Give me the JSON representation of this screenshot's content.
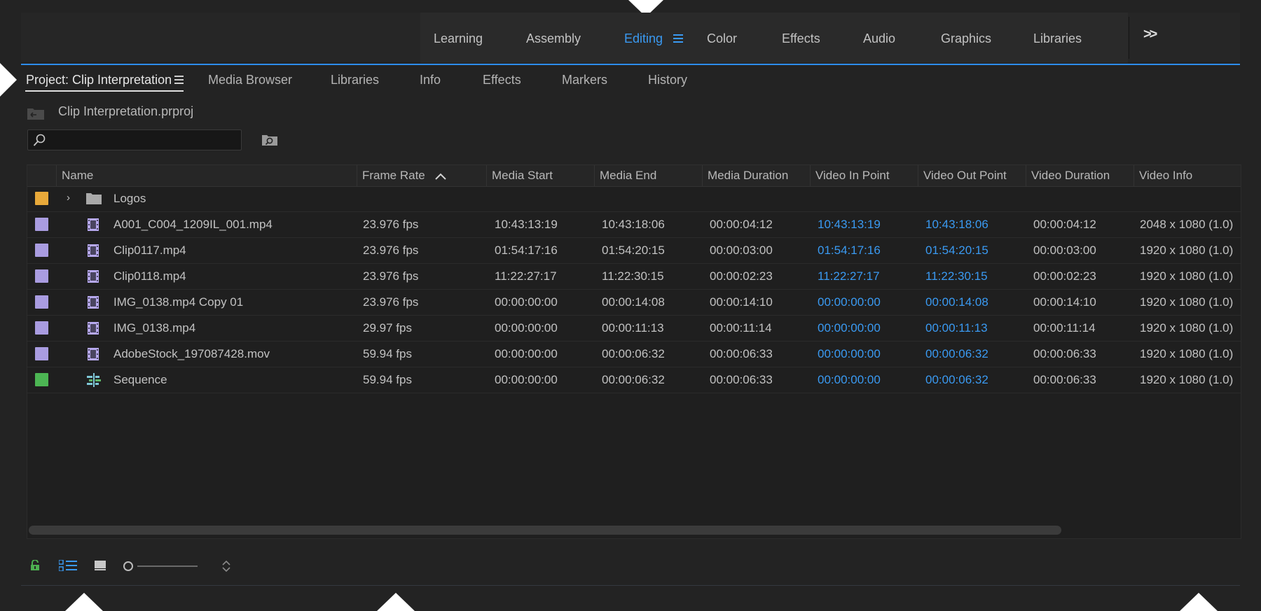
{
  "workspace": {
    "tabs": [
      {
        "label": "Learning"
      },
      {
        "label": "Assembly"
      },
      {
        "label": "Editing",
        "active": true
      },
      {
        "label": "Color"
      },
      {
        "label": "Effects"
      },
      {
        "label": "Audio"
      },
      {
        "label": "Graphics"
      },
      {
        "label": "Libraries"
      }
    ],
    "overflow_label": ">>"
  },
  "panel": {
    "tabs": [
      {
        "label": "Project: Clip Interpretation",
        "active": true
      },
      {
        "label": "Media Browser"
      },
      {
        "label": "Libraries"
      },
      {
        "label": "Info"
      },
      {
        "label": "Effects"
      },
      {
        "label": "Markers"
      },
      {
        "label": "History"
      }
    ]
  },
  "project": {
    "file_name": "Clip Interpretation.prproj"
  },
  "search": {
    "value": "",
    "placeholder": ""
  },
  "table": {
    "columns": [
      "Name",
      "Frame Rate",
      "Media Start",
      "Media End",
      "Media Duration",
      "Video In Point",
      "Video Out Point",
      "Video Duration",
      "Video Info"
    ],
    "sorted_column": "Frame Rate",
    "sort_direction": "ascending",
    "rows": [
      {
        "type": "bin",
        "label_color": "#e8a93a",
        "name": "Logos",
        "frame_rate": "",
        "media_start": "",
        "media_end": "",
        "media_duration": "",
        "video_in": "",
        "video_out": "",
        "video_duration": "",
        "video_info": ""
      },
      {
        "type": "clip",
        "label_color": "#a99ce0",
        "name": "A001_C004_1209IL_001.mp4",
        "frame_rate": "23.976 fps",
        "media_start": "10:43:13:19",
        "media_end": "10:43:18:06",
        "media_duration": "00:00:04:12",
        "video_in": "10:43:13:19",
        "video_out": "10:43:18:06",
        "video_duration": "00:00:04:12",
        "video_info": "2048 x 1080 (1.0)"
      },
      {
        "type": "clip",
        "label_color": "#a99ce0",
        "name": "Clip0117.mp4",
        "frame_rate": "23.976 fps",
        "media_start": "01:54:17:16",
        "media_end": "01:54:20:15",
        "media_duration": "00:00:03:00",
        "video_in": "01:54:17:16",
        "video_out": "01:54:20:15",
        "video_duration": "00:00:03:00",
        "video_info": "1920 x 1080 (1.0)"
      },
      {
        "type": "clip",
        "label_color": "#a99ce0",
        "name": "Clip0118.mp4",
        "frame_rate": "23.976 fps",
        "media_start": "11:22:27:17",
        "media_end": "11:22:30:15",
        "media_duration": "00:00:02:23",
        "video_in": "11:22:27:17",
        "video_out": "11:22:30:15",
        "video_duration": "00:00:02:23",
        "video_info": "1920 x 1080 (1.0)"
      },
      {
        "type": "clip",
        "label_color": "#a99ce0",
        "name": "IMG_0138.mp4 Copy 01",
        "frame_rate": "23.976 fps",
        "media_start": "00:00:00:00",
        "media_end": "00:00:14:08",
        "media_duration": "00:00:14:10",
        "video_in": "00:00:00:00",
        "video_out": "00:00:14:08",
        "video_duration": "00:00:14:10",
        "video_info": "1920 x 1080 (1.0)"
      },
      {
        "type": "clip",
        "label_color": "#a99ce0",
        "name": "IMG_0138.mp4",
        "frame_rate": "29.97 fps",
        "media_start": "00:00:00:00",
        "media_end": "00:00:11:13",
        "media_duration": "00:00:11:14",
        "video_in": "00:00:00:00",
        "video_out": "00:00:11:13",
        "video_duration": "00:00:11:14",
        "video_info": "1920 x 1080 (1.0)"
      },
      {
        "type": "clip",
        "label_color": "#a99ce0",
        "name": "AdobeStock_197087428.mov",
        "frame_rate": "59.94 fps",
        "media_start": "00:00:00:00",
        "media_end": "00:00:06:32",
        "media_duration": "00:00:06:33",
        "video_in": "00:00:00:00",
        "video_out": "00:00:06:32",
        "video_duration": "00:00:06:33",
        "video_info": "1920 x 1080 (1.0)"
      },
      {
        "type": "sequence",
        "label_color": "#4cb553",
        "name": "Sequence",
        "frame_rate": "59.94 fps",
        "media_start": "00:00:00:00",
        "media_end": "00:00:06:32",
        "media_duration": "00:00:06:33",
        "video_in": "00:00:00:00",
        "video_out": "00:00:06:32",
        "video_duration": "00:00:06:33",
        "video_info": "1920 x 1080 (1.0)"
      }
    ]
  },
  "footer": {
    "icons": [
      "lock-icon",
      "list-view-icon",
      "icon-view-icon",
      "zoom-slider",
      "sort-icons"
    ]
  },
  "colors": {
    "accent": "#3a9af2",
    "background": "#232323",
    "bin_label": "#e8a93a",
    "clip_label": "#a99ce0",
    "sequence_label": "#4cb553",
    "lock": "#4caf50"
  }
}
